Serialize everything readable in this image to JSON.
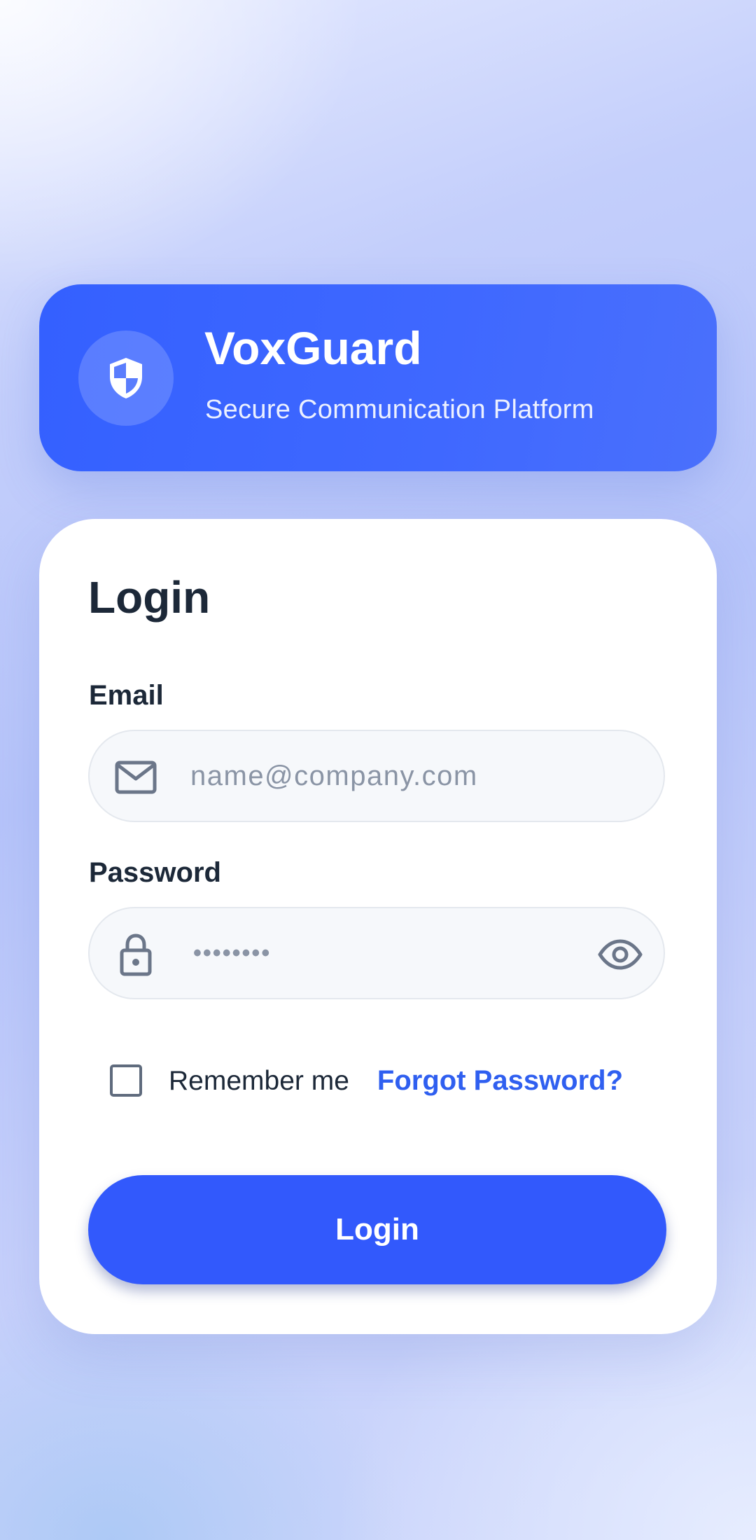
{
  "app": {
    "name": "VoxGuard",
    "tagline": "Secure Communication Platform",
    "logo_icon": "shield-icon"
  },
  "login": {
    "heading": "Login",
    "email": {
      "label": "Email",
      "placeholder": "name@company.com",
      "value": "",
      "icon": "mail-icon"
    },
    "password": {
      "label": "Password",
      "masked_value": "••••••••",
      "icon": "lock-icon",
      "toggle_icon": "eye-icon"
    },
    "remember_me": {
      "label": "Remember me",
      "checked": false
    },
    "forgot_password_label": "Forgot Password?",
    "submit_label": "Login"
  },
  "colors": {
    "primary": "#3259fc",
    "link": "#2f5ff0",
    "heading_text": "#1c2838",
    "muted_text": "#8a94a5"
  }
}
